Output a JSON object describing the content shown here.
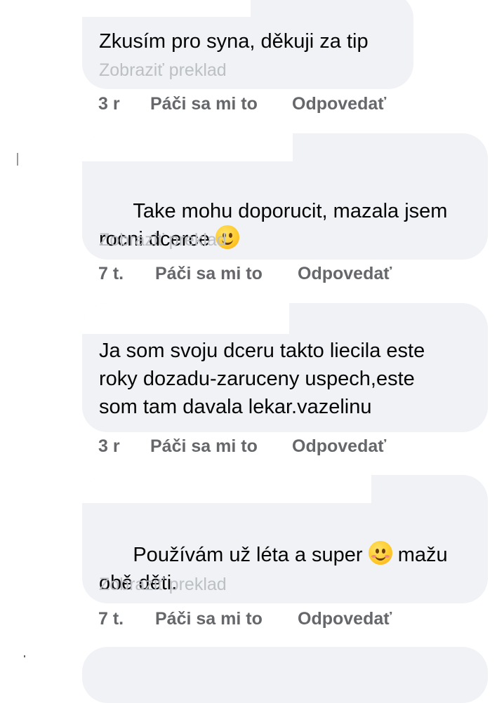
{
  "comments": [
    {
      "text": "Zkusím pro syna, děkuji za tip",
      "translate": "Zobraziť preklad",
      "time": "3 r",
      "like": "Páči sa mi to",
      "reply": "Odpovedať"
    },
    {
      "text_line1": "Take mohu doporucit, mazala jsem",
      "text_line2": "rocni dcerce",
      "emoji": "smiling-face-icon",
      "translate": "Zobraziť preklad",
      "time": "7 t.",
      "like": "Páči sa mi to",
      "reply": "Odpovedať"
    },
    {
      "text": "Ja som svoju dceru takto liecila este\nroky dozadu-zaruceny uspech,este\nsom tam davala lekar.vazelinu",
      "time": "3 r",
      "like": "Páči sa mi to",
      "reply": "Odpovedať"
    },
    {
      "text_before_emoji": "Používám už léta a super",
      "emoji": "smiling-face-with-smiling-eyes-icon",
      "text_after_emoji": "mažu",
      "text_line2": "obě děti.",
      "translate": "Zobraziť preklad",
      "time": "7 t.",
      "like": "Páči sa mi to",
      "reply": "Odpovedať"
    }
  ],
  "colors": {
    "bubble": "#f0f2f5",
    "text": "#050505",
    "meta": "#65676b",
    "translate": "#bcc0c4"
  }
}
